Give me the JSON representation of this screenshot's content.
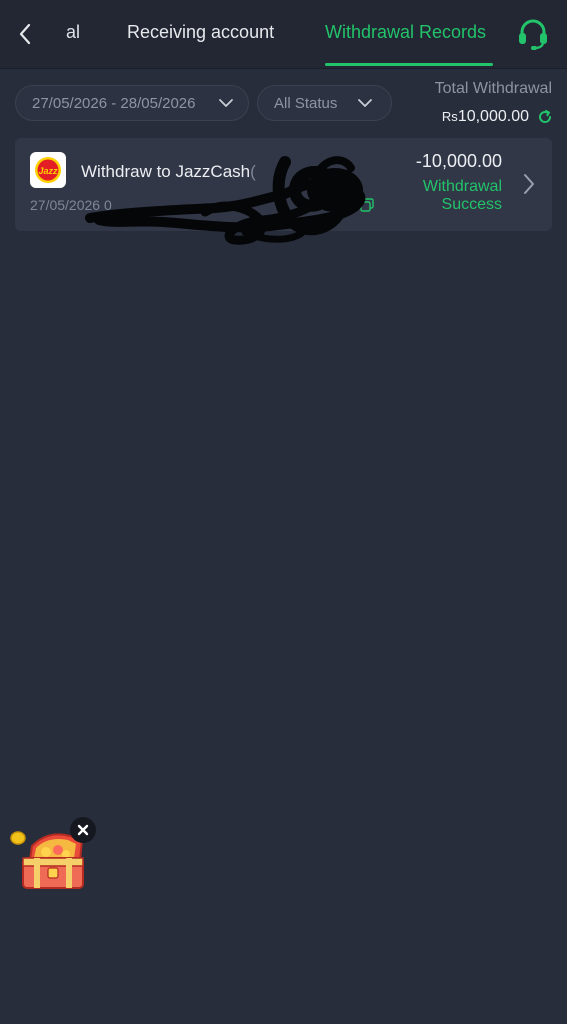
{
  "header": {
    "back_icon": "chevron-left-icon",
    "tabs": [
      {
        "label": "al",
        "active": false
      },
      {
        "label": "Receiving account",
        "active": false
      },
      {
        "label": "Withdrawal Records",
        "active": true
      }
    ],
    "support_icon": "headset-icon",
    "accent_color": "#22c36a"
  },
  "filters": {
    "date_range": "27/05/2026 - 28/05/2026",
    "status": "All Status"
  },
  "summary": {
    "label": "Total Withdrawal",
    "currency": "Rs",
    "amount": "10,000.00",
    "refresh_icon": "refresh-icon"
  },
  "records": [
    {
      "title": "Withdraw to JazzCash",
      "title_suffix": "(",
      "date": "27/05/2026 0",
      "amount": "-10,000.00",
      "status": "Withdrawal Success",
      "logo_text": "Jazz",
      "logo_color": "#e31e24"
    }
  ],
  "floating": {
    "treasure_icon": "treasure-chest-icon",
    "close_icon": "close-icon"
  }
}
